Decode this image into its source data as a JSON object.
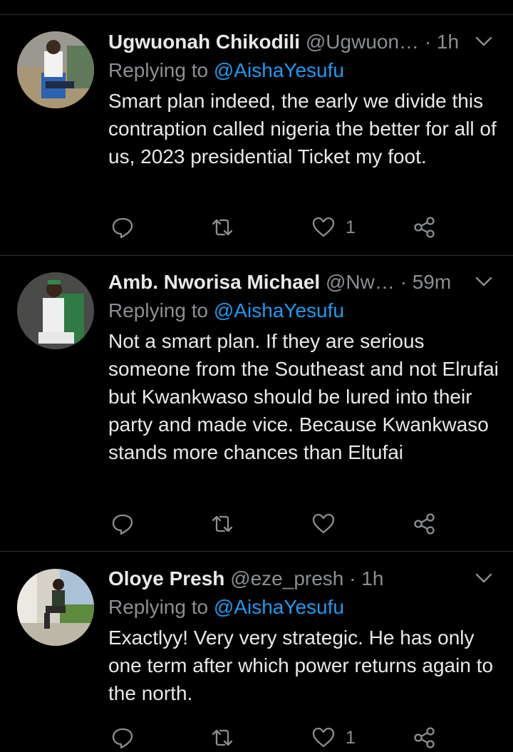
{
  "tweets": [
    {
      "name": "Ugwuonah Chikodili",
      "handle": "@Ugwuon…",
      "time": "1h",
      "replying_label": "Replying to",
      "replying_to": "@AishaYesufu",
      "text": "Smart plan indeed, the early we divide this contraption called nigeria the better for all of us, 2023 presidential Ticket my foot.",
      "like_count": "1"
    },
    {
      "name": "Amb. Nworisa Michael",
      "handle": "@Nw…",
      "time": "59m",
      "replying_label": "Replying to",
      "replying_to": "@AishaYesufu",
      "text": "Not a smart plan. If they are serious someone from the Southeast and not Elrufai but Kwankwaso should be lured into their party and made vice. Because Kwankwaso stands more chances than Eltufai",
      "like_count": ""
    },
    {
      "name": "Oloye Presh",
      "handle": "@eze_presh",
      "time": "1h",
      "replying_label": "Replying to",
      "replying_to": "@AishaYesufu",
      "text": "Exactlyy! Very very strategic. He has only one term after which  power returns again to the north.",
      "like_count": "1"
    }
  ],
  "separator_dot": "·",
  "colors": {
    "background": "#000000",
    "mention": "#1d9bf0",
    "muted": "#8b8f93",
    "text": "#e7e9ea"
  },
  "icons": [
    "chevron-down-icon",
    "reply-icon",
    "retweet-icon",
    "heart-icon",
    "share-icon"
  ]
}
